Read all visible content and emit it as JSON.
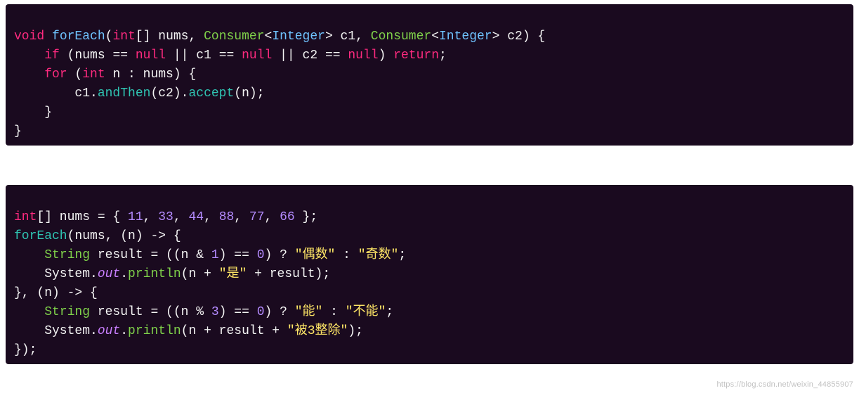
{
  "block1": {
    "l1": {
      "t1": "void",
      "t2": " ",
      "t3": "forEach",
      "t4": "(",
      "t5": "int",
      "t6": "[] nums, ",
      "t7": "Consumer",
      "t8": "<",
      "t9": "Integer",
      "t10": "> c1, ",
      "t11": "Consumer",
      "t12": "<",
      "t13": "Integer",
      "t14": "> c2) {"
    },
    "l2": {
      "t1": "    ",
      "t2": "if",
      "t3": " (nums == ",
      "t4": "null",
      "t5": " || c1 == ",
      "t6": "null",
      "t7": " || c2 == ",
      "t8": "null",
      "t9": ") ",
      "t10": "return",
      "t11": ";"
    },
    "l3": {
      "t1": "    ",
      "t2": "for",
      "t3": " (",
      "t4": "int",
      "t5": " n : nums) {"
    },
    "l4": {
      "t1": "        c1.",
      "t2": "andThen",
      "t3": "(c2).",
      "t4": "accept",
      "t5": "(n);"
    },
    "l5": {
      "t1": "    }"
    },
    "l6": {
      "t1": "}"
    }
  },
  "block2": {
    "l1": {
      "t1": "int",
      "t2": "[] nums = { ",
      "t3": "11",
      "t4": ", ",
      "t5": "33",
      "t6": ", ",
      "t7": "44",
      "t8": ", ",
      "t9": "88",
      "t10": ", ",
      "t11": "77",
      "t12": ", ",
      "t13": "66",
      "t14": " };"
    },
    "l2": {
      "t1": "forEach",
      "t2": "(nums, (n) -> {"
    },
    "l3": {
      "t1": "    ",
      "t2": "String",
      "t3": " result = ((n & ",
      "t4": "1",
      "t5": ") == ",
      "t6": "0",
      "t7": ") ? ",
      "t8": "\"偶数\"",
      "t9": " : ",
      "t10": "\"奇数\"",
      "t11": ";"
    },
    "l4": {
      "t1": "    System.",
      "t2": "out",
      "t3": ".",
      "t4": "println",
      "t5": "(n + ",
      "t6": "\"是\"",
      "t7": " + result);"
    },
    "l5": {
      "t1": "}, (n) -> {"
    },
    "l6": {
      "t1": "    ",
      "t2": "String",
      "t3": " result = ((n % ",
      "t4": "3",
      "t5": ") == ",
      "t6": "0",
      "t7": ") ? ",
      "t8": "\"能\"",
      "t9": " : ",
      "t10": "\"不能\"",
      "t11": ";"
    },
    "l7": {
      "t1": "    System.",
      "t2": "out",
      "t3": ".",
      "t4": "println",
      "t5": "(n + result + ",
      "t6": "\"被3整除\"",
      "t7": ");"
    },
    "l8": {
      "t1": "});"
    }
  },
  "watermark": "https://blog.csdn.net/weixin_44855907"
}
